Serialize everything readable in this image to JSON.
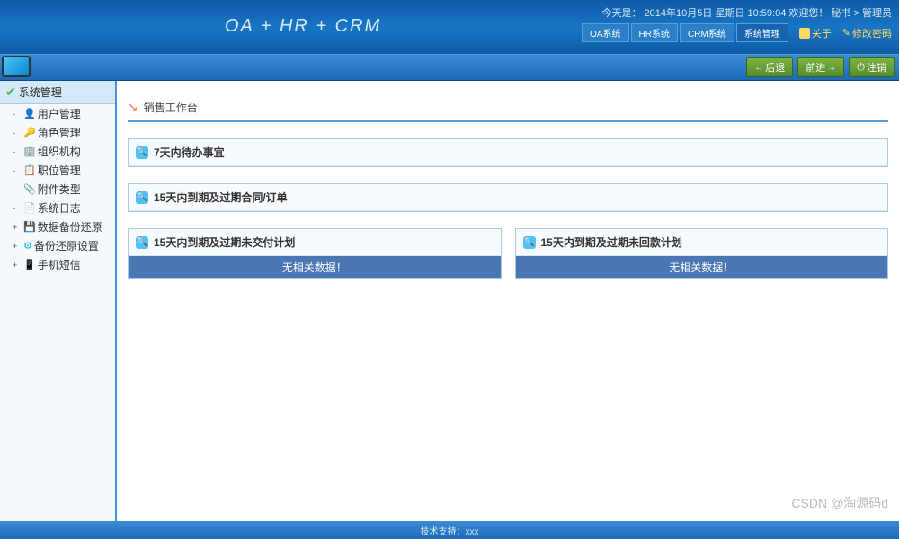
{
  "header": {
    "title": "OA + HR + CRM",
    "date_label": "今天是：",
    "date": "2014年10月5日",
    "weekday": "星期日",
    "time": "10:59:04",
    "welcome": "欢迎您！",
    "user_role": "秘书 > 管理员",
    "tabs": [
      "OA系统",
      "HR系统",
      "CRM系统",
      "系统管理"
    ],
    "about": "关于",
    "change_pwd": "修改密码"
  },
  "toolbar": {
    "back": "后退",
    "forward": "前进",
    "refresh": "注销"
  },
  "sidebar": {
    "title": "系统管理",
    "items": [
      {
        "label": "用户管理",
        "icon": "user"
      },
      {
        "label": "角色管理",
        "icon": "role"
      },
      {
        "label": "组织机构",
        "icon": "org"
      },
      {
        "label": "职位管理",
        "icon": "pos"
      },
      {
        "label": "附件类型",
        "icon": "att"
      },
      {
        "label": "系统日志",
        "icon": "log"
      },
      {
        "label": "数据备份还原",
        "icon": "backup"
      },
      {
        "label": "备份还原设置",
        "icon": "restore"
      },
      {
        "label": "手机短信",
        "icon": "sms"
      }
    ]
  },
  "workspace": {
    "title": "销售工作台",
    "panels": [
      {
        "title": "7天内待办事宜"
      },
      {
        "title": "15天内到期及过期合同/订单"
      }
    ],
    "bottom_panels": [
      {
        "title": "15天内到期及过期未交付计划",
        "nodata": "无相关数据！"
      },
      {
        "title": "15天内到期及过期未回款计划",
        "nodata": "无相关数据！"
      }
    ]
  },
  "footer": "技术支持：xxx",
  "watermark": "CSDN @淘源码d"
}
